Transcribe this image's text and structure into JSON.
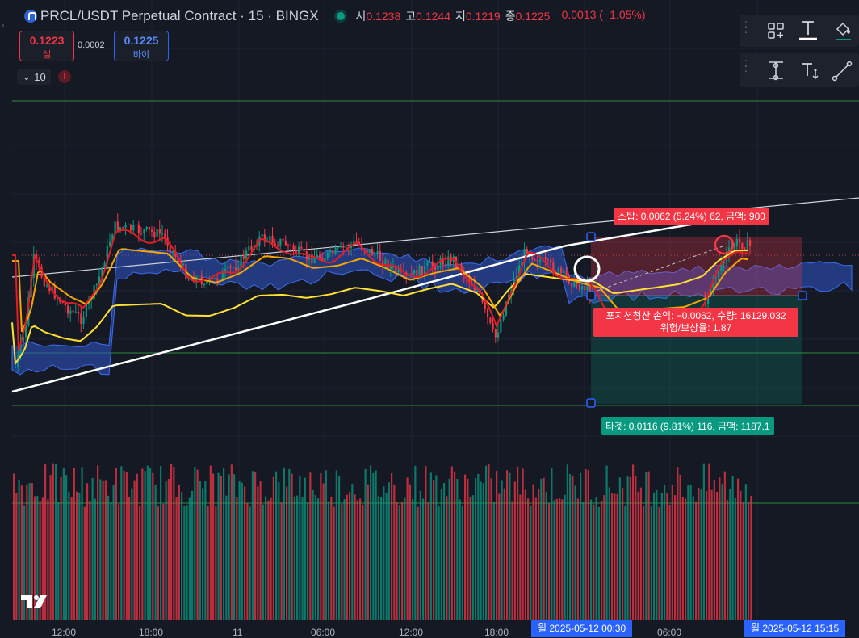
{
  "header": {
    "title": "PRCL/USDT Perpetual Contract · 15 · BINGX",
    "ohlc": [
      {
        "label": "시",
        "value": "0.1238"
      },
      {
        "label": "고",
        "value": "0.1244"
      },
      {
        "label": "저",
        "value": "0.1219"
      },
      {
        "label": "종",
        "value": "0.1225"
      }
    ],
    "change": "−0.0013 (−1.05%)"
  },
  "trade": {
    "sell_price": "0.1223",
    "sell_label": "셀",
    "spread": "0.0002",
    "buy_price": "0.1225",
    "buy_label": "바이"
  },
  "interval": {
    "value": "10"
  },
  "alert": {
    "symbol": "!"
  },
  "position": {
    "stop_label": "스탑: 0.0062 (5.24%) 62, 금액: 900",
    "pnl_line1": "포지션청산 손익: −0.0062, 수량: 16129.032",
    "pnl_line2": "위험/보상율: 1.87",
    "target_label": "타겟: 0.0116 (9.81%) 116, 금액: 1187.1"
  },
  "time_axis": {
    "ticks": [
      "12:00",
      "18:00",
      "11",
      "06:00",
      "12:00",
      "18:00",
      "06:00",
      "15:15"
    ],
    "highlight_left": "월 2025-05-12   00:30",
    "highlight_right": "월 2025-05-12   15:15"
  },
  "toolbar": {
    "icons": [
      "shapes-icon",
      "text-tool-icon",
      "fill-icon",
      "measure-icon",
      "anchored-text-icon",
      "trendline-icon"
    ]
  },
  "colors": {
    "background": "#151924",
    "bull": "#089981",
    "bear": "#f23645",
    "accent": "#2962ff",
    "ema_fast": "#e11d25",
    "ema_mid": "#f7a600",
    "ema_slow": "#ffe135",
    "ema_long": "#ffffff",
    "cloud": "#2f55c8"
  }
}
